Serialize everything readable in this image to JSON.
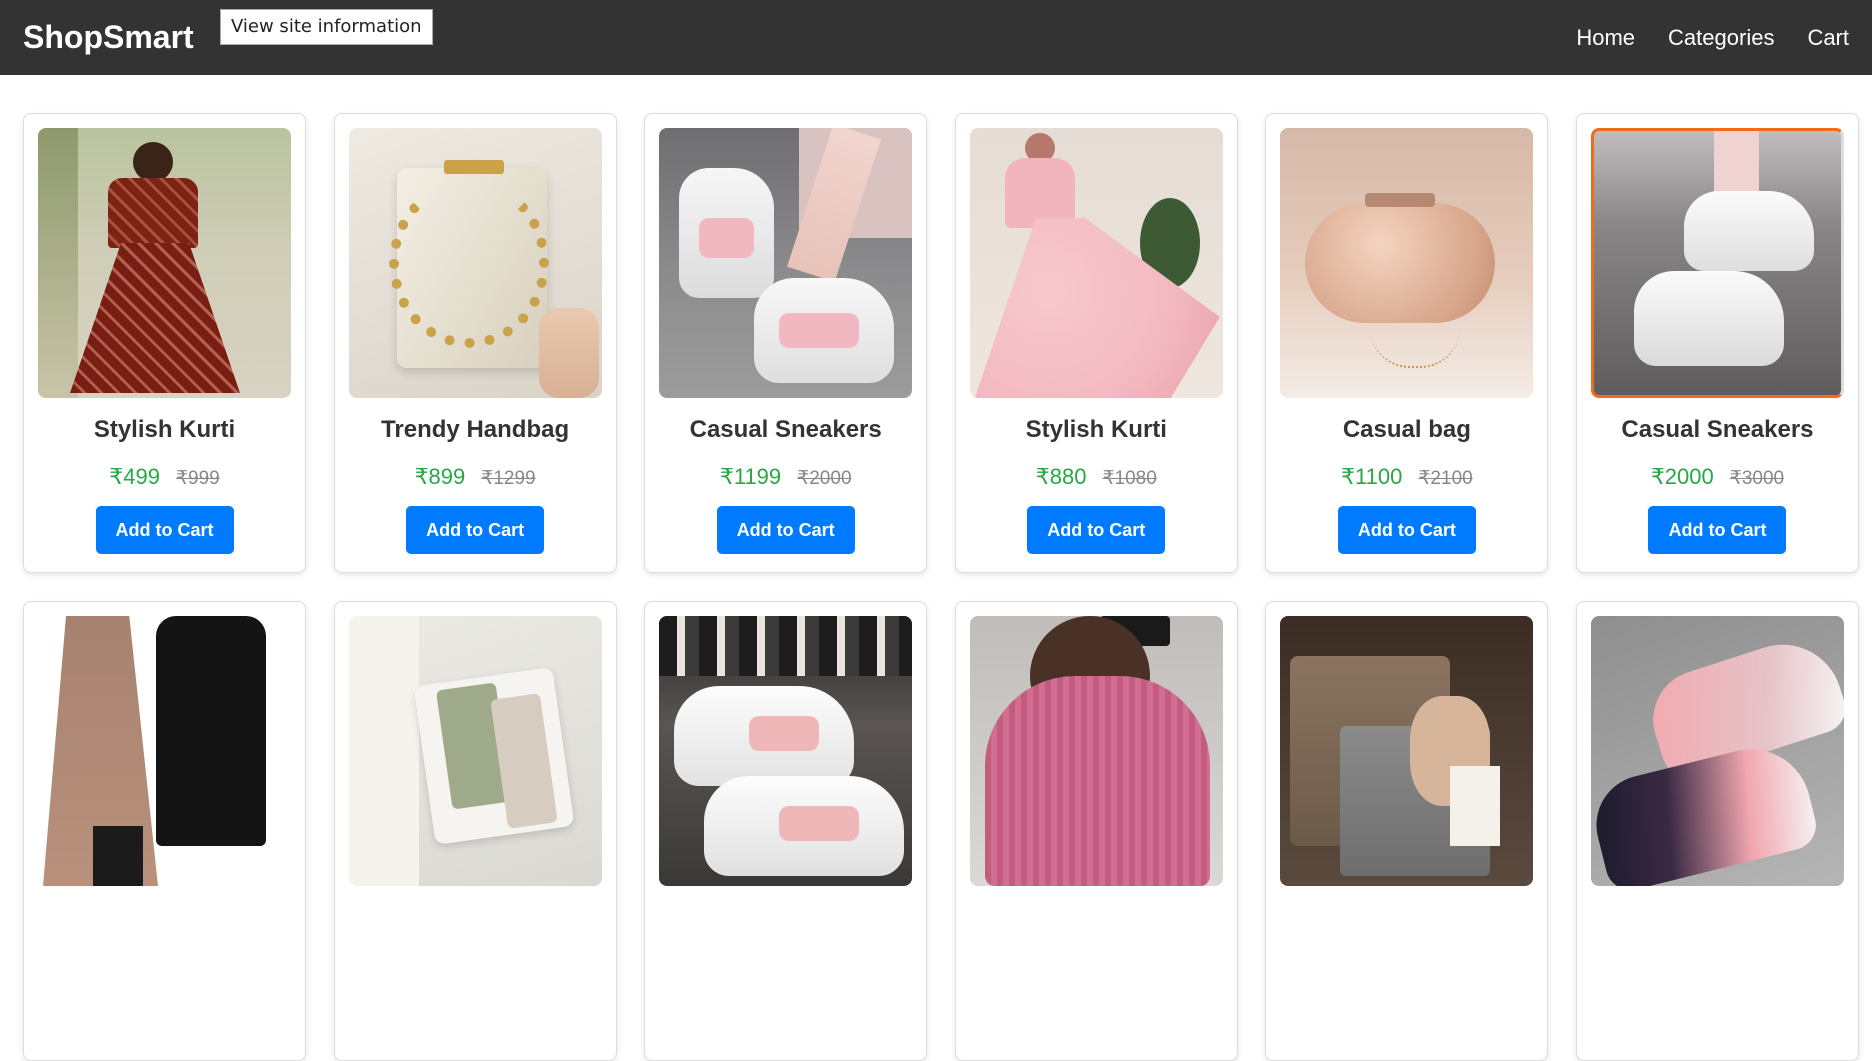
{
  "header": {
    "logo": "ShopSmart",
    "site_info": "View site information",
    "nav": [
      "Home",
      "Categories",
      "Cart"
    ]
  },
  "products": [
    {
      "name": "Stylish Kurti",
      "price": "₹499",
      "old_price": "₹999",
      "button": "Add to Cart",
      "image": "maroon-print-dress"
    },
    {
      "name": "Trendy Handbag",
      "price": "₹899",
      "old_price": "₹1299",
      "button": "Add to Cart",
      "image": "cream-chain-handbag"
    },
    {
      "name": "Casual Sneakers",
      "price": "₹1199",
      "old_price": "₹2000",
      "button": "Add to Cart",
      "image": "pink-grey-chunky-sneakers"
    },
    {
      "name": "Stylish Kurti",
      "price": "₹880",
      "old_price": "₹1080",
      "button": "Add to Cart",
      "image": "pink-floral-gown"
    },
    {
      "name": "Casual bag",
      "price": "₹1100",
      "old_price": "₹2100",
      "button": "Add to Cart",
      "image": "rose-gold-clutch"
    },
    {
      "name": "Casual Sneakers",
      "price": "₹2000",
      "old_price": "₹3000",
      "button": "Add to Cart",
      "image": "white-platform-sneakers"
    },
    {
      "image": "brown-coat-black-dress"
    },
    {
      "image": "sage-green-crossbody-bag"
    },
    {
      "image": "white-pink-sneakers"
    },
    {
      "image": "pink-knit-sweater"
    },
    {
      "image": "grey-kelly-bag"
    },
    {
      "image": "pink-galaxy-sneakers"
    }
  ],
  "colors": {
    "header_bg": "#333333",
    "accent": "#007bff",
    "price": "#28a745"
  }
}
